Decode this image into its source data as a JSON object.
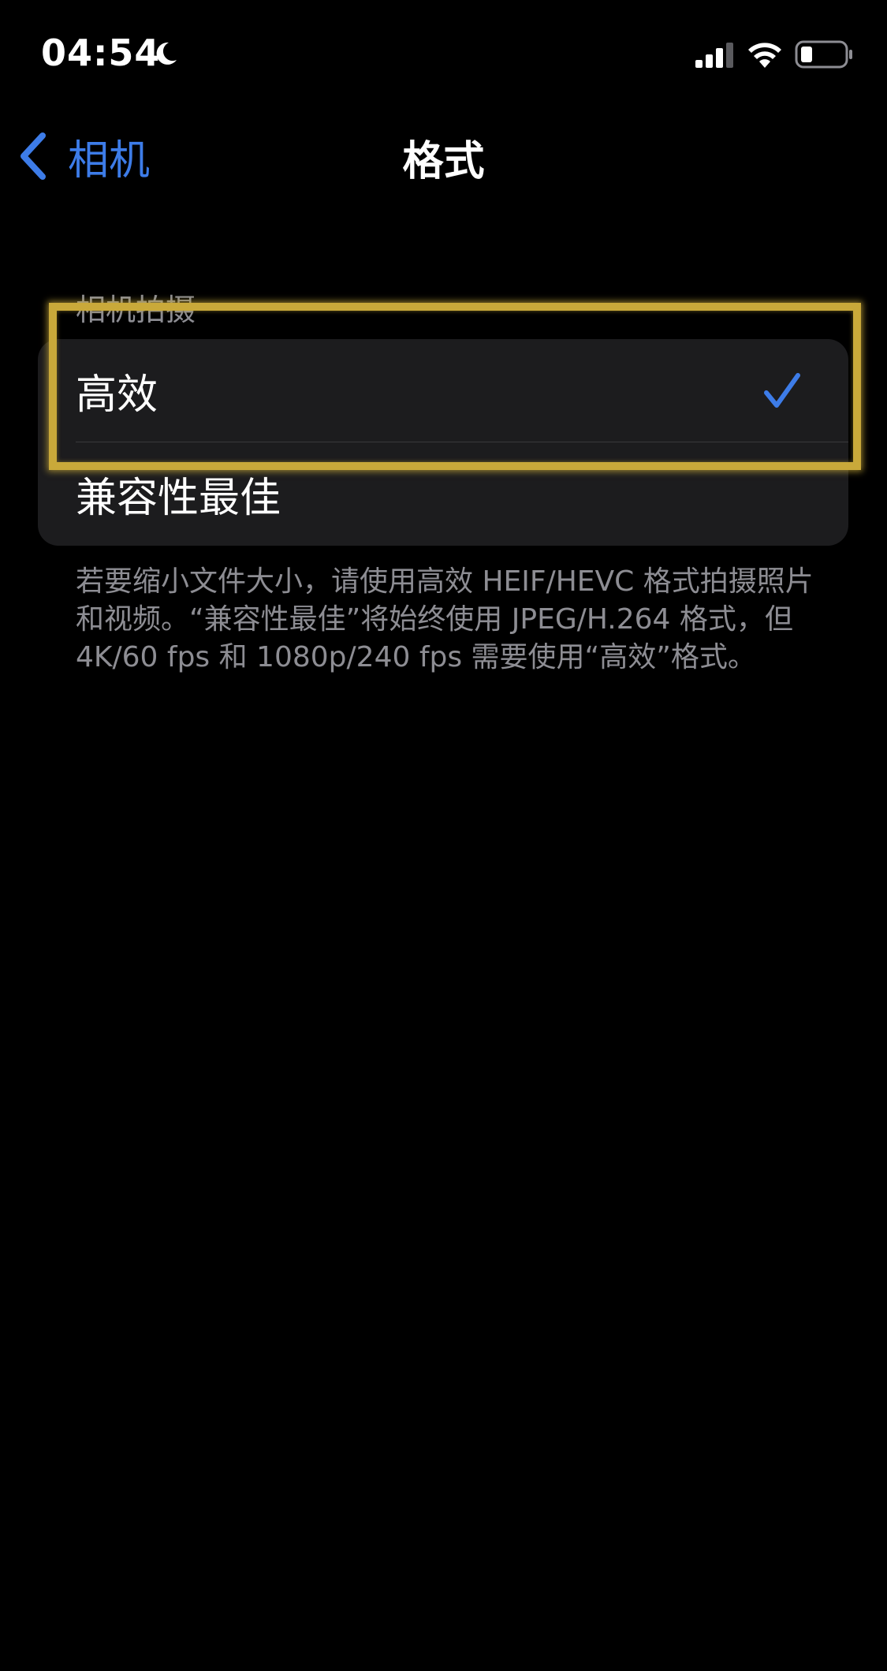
{
  "status_bar": {
    "time": "04:54",
    "moon": "moon-icon",
    "signal": "cellular-signal-icon",
    "wifi": "wifi-icon",
    "battery": "battery-icon"
  },
  "nav": {
    "back_label": "相机",
    "title": "格式"
  },
  "section": {
    "header": "相机拍摄",
    "options": [
      {
        "label": "高效",
        "selected": true
      },
      {
        "label": "兼容性最佳",
        "selected": false
      }
    ],
    "footer": "若要缩小文件大小，请使用高效 HEIF/HEVC 格式拍摄照片和视频。“兼容性最佳”将始终使用 JPEG/H.264 格式，但 4K/60 fps 和 1080p/240 fps 需要使用“高效”格式。"
  },
  "colors": {
    "accent": "#3d7ce8",
    "highlight": "#c9a93a",
    "background": "#000000",
    "group_bg": "#1c1c1e",
    "secondary_text": "#8d8d93"
  }
}
